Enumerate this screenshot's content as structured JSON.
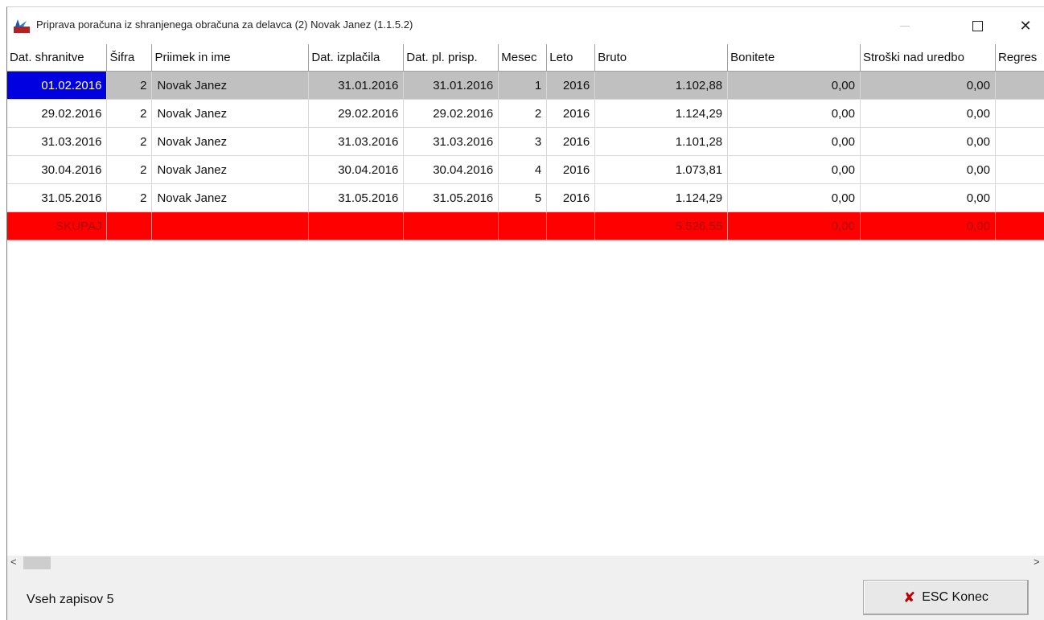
{
  "window": {
    "title": "Priprava poračuna iz shranjenega obračuna za delavca (2) Novak Janez  (1.1.5.2)",
    "icon": "app-icon",
    "controls": {
      "minimize": "—",
      "maximize": "□",
      "close": "✕"
    }
  },
  "grid": {
    "columns": [
      "Dat. shranitve",
      "Šifra",
      "Priimek in ime",
      "Dat. izplačila",
      "Dat. pl. prisp.",
      "Mesec",
      "Leto",
      "Bruto",
      "Bonitete",
      "Stroški nad uredbo",
      "Regres"
    ],
    "rows": [
      {
        "dat_shranitve": "01.02.2016",
        "sifra": "2",
        "ime": "Novak Janez",
        "dat_izplacila": "31.01.2016",
        "dat_pl_prisp": "31.01.2016",
        "mesec": "1",
        "leto": "2016",
        "bruto": "1.102,88",
        "bonitete": "0,00",
        "stroski": "0,00",
        "regres": ""
      },
      {
        "dat_shranitve": "29.02.2016",
        "sifra": "2",
        "ime": "Novak Janez",
        "dat_izplacila": "29.02.2016",
        "dat_pl_prisp": "29.02.2016",
        "mesec": "2",
        "leto": "2016",
        "bruto": "1.124,29",
        "bonitete": "0,00",
        "stroski": "0,00",
        "regres": ""
      },
      {
        "dat_shranitve": "31.03.2016",
        "sifra": "2",
        "ime": "Novak Janez",
        "dat_izplacila": "31.03.2016",
        "dat_pl_prisp": "31.03.2016",
        "mesec": "3",
        "leto": "2016",
        "bruto": "1.101,28",
        "bonitete": "0,00",
        "stroski": "0,00",
        "regres": ""
      },
      {
        "dat_shranitve": "30.04.2016",
        "sifra": "2",
        "ime": "Novak Janez",
        "dat_izplacila": "30.04.2016",
        "dat_pl_prisp": "30.04.2016",
        "mesec": "4",
        "leto": "2016",
        "bruto": "1.073,81",
        "bonitete": "0,00",
        "stroski": "0,00",
        "regres": ""
      },
      {
        "dat_shranitve": "31.05.2016",
        "sifra": "2",
        "ime": "Novak Janez",
        "dat_izplacila": "31.05.2016",
        "dat_pl_prisp": "31.05.2016",
        "mesec": "5",
        "leto": "2016",
        "bruto": "1.124,29",
        "bonitete": "0,00",
        "stroski": "0,00",
        "regres": ""
      }
    ],
    "total": {
      "label": "SKUPAJ",
      "bruto": "5.526,55",
      "bonitete": "0,00",
      "stroski": "0,00"
    },
    "selected_row": 0
  },
  "scrollbar": {
    "left_arrow": "<",
    "right_arrow": ">"
  },
  "status": {
    "record_count": "Vseh zapisov 5"
  },
  "buttons": {
    "esc_label": "ESC Konec",
    "esc_icon": "✘"
  },
  "colors": {
    "selected_cell": "#0000e0",
    "selected_row": "#c0c0c0",
    "total_row": "#ff0000"
  }
}
